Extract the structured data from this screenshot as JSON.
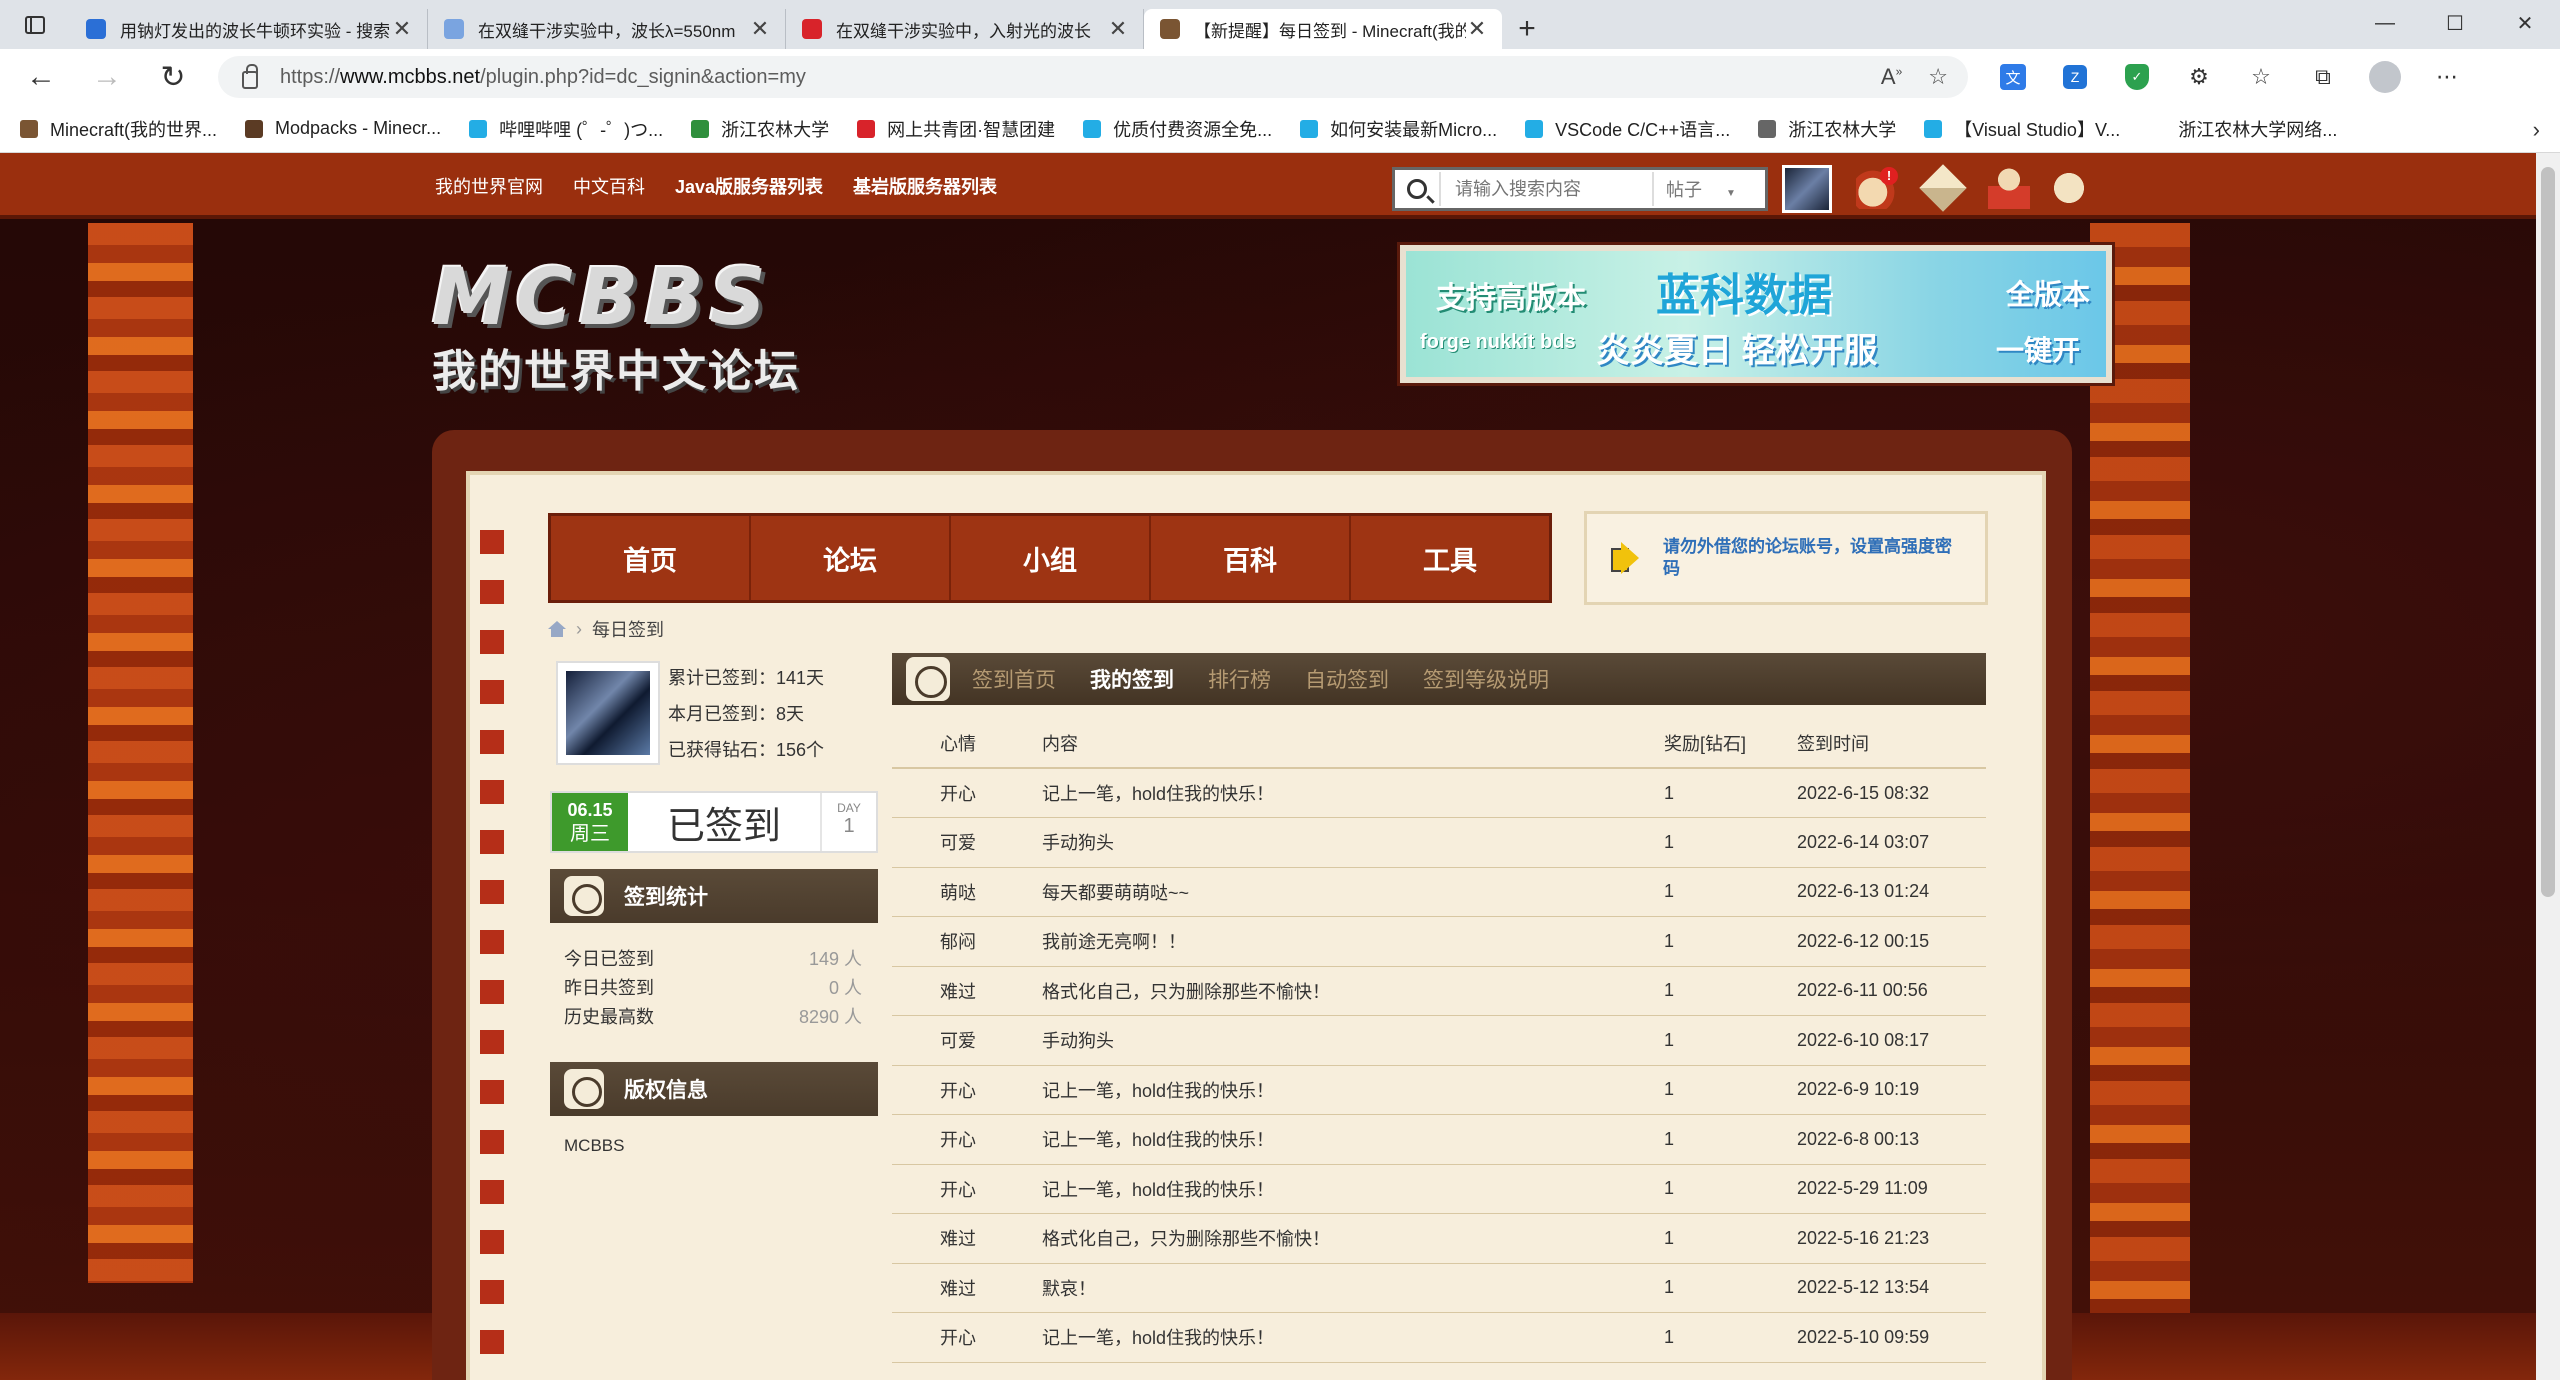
{
  "browser": {
    "tabs": [
      {
        "title": "用钠灯发出的波长牛顿环实验 - 搜索",
        "icon_color": "#2b6fd6",
        "active": false
      },
      {
        "title": "在双缝干涉实验中，波长λ=550nm",
        "icon_color": "#7aa4e0",
        "active": false
      },
      {
        "title": "在双缝干涉实验中，入射光的波长",
        "icon_color": "#d8232a",
        "active": false
      },
      {
        "title": "【新提醒】每日签到 - Minecraft(我的世界)中文论坛",
        "icon_color": "#7a5533",
        "active": true
      }
    ],
    "url_prefix": "https://",
    "url_host": "www.mcbbs.net",
    "url_path": "/plugin.php?id=dc_signin&action=my",
    "bookmarks": [
      {
        "label": "Minecraft(我的世界...",
        "icon_color": "#7a5533"
      },
      {
        "label": "Modpacks - Minecr...",
        "icon_color": "#5b3b24"
      },
      {
        "label": "哔哩哔哩 (゜-゜)つ...",
        "icon_color": "#23ade5"
      },
      {
        "label": "浙江农林大学",
        "icon_color": "#2f8f3c"
      },
      {
        "label": "网上共青团·智慧团建",
        "icon_color": "#d8232a"
      },
      {
        "label": "优质付费资源全免...",
        "icon_color": "#23ade5"
      },
      {
        "label": "如何安装最新Micro...",
        "icon_color": "#23ade5"
      },
      {
        "label": "VSCode C/C++语言...",
        "icon_color": "#23ade5"
      },
      {
        "label": "浙江农林大学",
        "icon_color": "#666666"
      },
      {
        "label": "【Visual Studio】V...",
        "icon_color": "#23ade5"
      },
      {
        "label": "浙江农林大学网络...",
        "icon_color": "#ffffff"
      }
    ]
  },
  "site": {
    "topnav_links": [
      "我的世界官网",
      "中文百科",
      "Java版服务器列表",
      "基岩版服务器列表"
    ],
    "search_placeholder": "请输入搜索内容",
    "search_scope": "帖子",
    "notify_count": "!",
    "logo_main": "MCBBS",
    "logo_sub": "我的世界中文论坛",
    "banner": {
      "t1": "支持高版本",
      "t2": "蓝科数据",
      "t3": "forge nukkit bds",
      "t4": "炎炎夏日 轻松开服",
      "t5": "全版本",
      "t6": "一键开服"
    },
    "main_nav": [
      "首页",
      "论坛",
      "小组",
      "百科",
      "工具"
    ],
    "notice": "请勿外借您的论坛账号，设置高强度密码",
    "breadcrumb": "每日签到"
  },
  "profile": {
    "total_days": "累计已签到：141天",
    "month_days": "本月已签到：8天",
    "diamonds": "已获得钻石：156个"
  },
  "signin": {
    "date": "06.15",
    "weekday": "周三",
    "status": "已签到",
    "day_label": "DAY",
    "day_value": "1"
  },
  "stats_box": {
    "title": "签到统计",
    "rows": [
      {
        "label": "今日已签到",
        "value": "149 人"
      },
      {
        "label": "昨日共签到",
        "value": "0 人"
      },
      {
        "label": "历史最高数",
        "value": "8290 人"
      }
    ]
  },
  "copyright_box": {
    "title": "版权信息",
    "text": "MCBBS"
  },
  "sign_tabs": [
    {
      "label": "签到首页",
      "active": false
    },
    {
      "label": "我的签到",
      "active": true
    },
    {
      "label": "排行榜",
      "active": false
    },
    {
      "label": "自动签到",
      "active": false
    },
    {
      "label": "签到等级说明",
      "active": false
    }
  ],
  "table": {
    "headers": [
      "心情",
      "内容",
      "奖励[钻石]",
      "签到时间"
    ],
    "rows": [
      [
        "开心",
        "记上一笔，hold住我的快乐！",
        "1",
        "2022-6-15 08:32"
      ],
      [
        "可爱",
        "手动狗头",
        "1",
        "2022-6-14 03:07"
      ],
      [
        "萌哒",
        "每天都要萌萌哒~~",
        "1",
        "2022-6-13 01:24"
      ],
      [
        "郁闷",
        "我前途无亮啊！！",
        "1",
        "2022-6-12 00:15"
      ],
      [
        "难过",
        "格式化自己，只为删除那些不愉快！",
        "1",
        "2022-6-11 00:56"
      ],
      [
        "可爱",
        "手动狗头",
        "1",
        "2022-6-10 08:17"
      ],
      [
        "开心",
        "记上一笔，hold住我的快乐！",
        "1",
        "2022-6-9 10:19"
      ],
      [
        "开心",
        "记上一笔，hold住我的快乐！",
        "1",
        "2022-6-8 00:13"
      ],
      [
        "开心",
        "记上一笔，hold住我的快乐！",
        "1",
        "2022-5-29 11:09"
      ],
      [
        "难过",
        "格式化自己，只为删除那些不愉快！",
        "1",
        "2022-5-16 21:23"
      ],
      [
        "难过",
        "默哀！",
        "1",
        "2022-5-12 13:54"
      ],
      [
        "开心",
        "记上一笔，hold住我的快乐！",
        "1",
        "2022-5-10 09:59"
      ]
    ]
  }
}
